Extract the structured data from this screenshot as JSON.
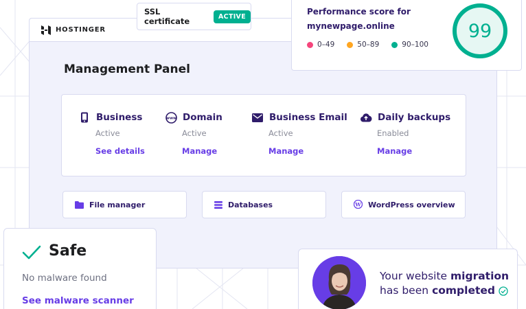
{
  "brand": {
    "name": "HOSTINGER"
  },
  "ssl": {
    "label": "SSL certificate",
    "badge": "ACTIVE"
  },
  "performance": {
    "line1": "Performance score for",
    "line2": "mynewpage.online",
    "score": "99",
    "legend": [
      {
        "label": "0–49",
        "color": "#f5457c"
      },
      {
        "label": "50–89",
        "color": "#ffa621"
      },
      {
        "label": "90–100",
        "color": "#00b090"
      }
    ]
  },
  "panel": {
    "title": "Management Panel",
    "services": [
      {
        "name": "Business",
        "status": "Active",
        "link": "See details",
        "icon": "phone-icon"
      },
      {
        "name": "Domain",
        "status": "Active",
        "link": "Manage",
        "icon": "www-globe-icon"
      },
      {
        "name": "Business Email",
        "status": "Active",
        "link": "Manage",
        "icon": "envelope-icon"
      },
      {
        "name": "Daily backups",
        "status": "Enabled",
        "link": "Manage",
        "icon": "cloud-upload-icon"
      }
    ],
    "quick": [
      {
        "label": "File manager",
        "icon": "folder-icon"
      },
      {
        "label": "Databases",
        "icon": "database-icon"
      },
      {
        "label": "WordPress overview",
        "icon": "wordpress-icon"
      }
    ]
  },
  "safe": {
    "title": "Safe",
    "subtitle": "No malware found",
    "link": "See malware scanner"
  },
  "migration": {
    "pre": "Your website",
    "bold1": "migration",
    "mid": "has been",
    "bold2": "completed"
  },
  "colors": {
    "accent": "#673de6",
    "success": "#00b090",
    "navy": "#2f1c6a"
  }
}
